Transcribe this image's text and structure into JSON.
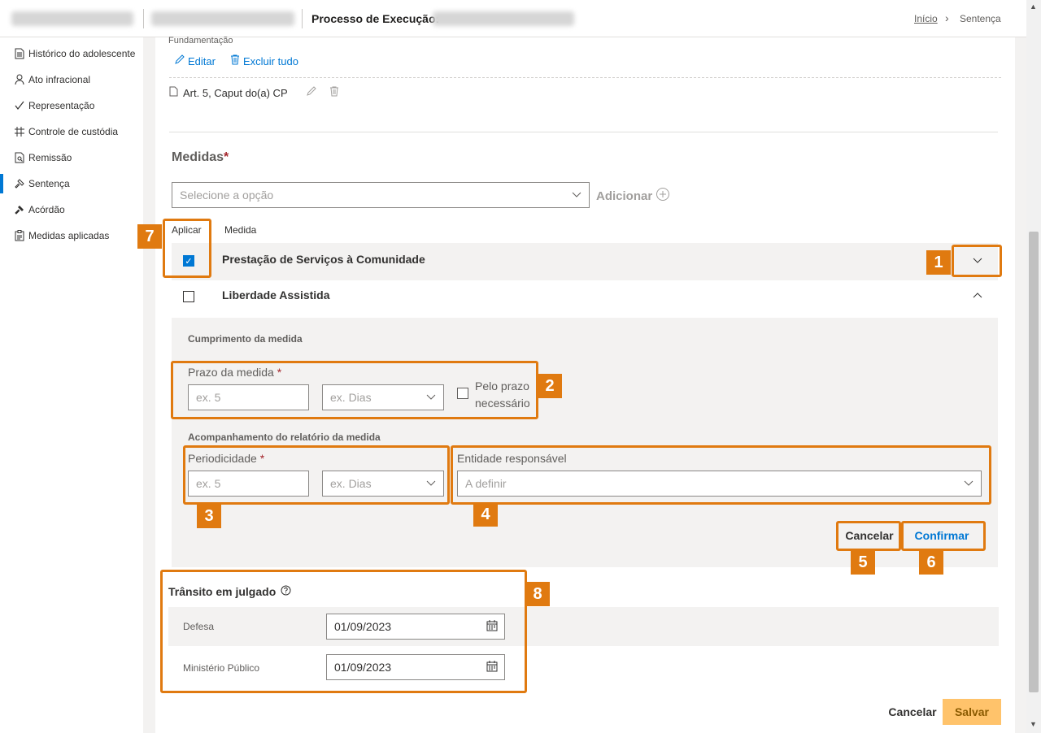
{
  "header": {
    "process_label": "Processo de Execução:",
    "breadcrumb_home": "Início",
    "breadcrumb_current": "Sentença"
  },
  "sidebar": {
    "items": [
      {
        "label": "Histórico do adolescente",
        "icon": "document-icon"
      },
      {
        "label": "Ato infracional",
        "icon": "person-icon"
      },
      {
        "label": "Representação",
        "icon": "check-icon"
      },
      {
        "label": "Controle de custódia",
        "icon": "grid-icon"
      },
      {
        "label": "Remissão",
        "icon": "document-search-icon"
      },
      {
        "label": "Sentença",
        "icon": "gavel-icon",
        "active": true
      },
      {
        "label": "Acórdão",
        "icon": "gavel-filled-icon"
      },
      {
        "label": "Medidas aplicadas",
        "icon": "clipboard-icon"
      }
    ]
  },
  "fundamentacao": {
    "label": "Fundamentação",
    "edit_label": "Editar",
    "delete_all_label": "Excluir tudo",
    "item_label": "Art. 5, Caput do(a) CP"
  },
  "medidas": {
    "title": "Medidas",
    "required_mark": "*",
    "select_placeholder": "Selecione a opção",
    "add_label": "Adicionar",
    "col_apply": "Aplicar",
    "col_measure": "Medida",
    "rows": [
      {
        "label": "Prestação de Serviços à Comunidade",
        "checked": true
      },
      {
        "label": "Liberdade Assistida",
        "checked": false
      }
    ]
  },
  "detail": {
    "cumprimento_label": "Cumprimento da medida",
    "prazo_label": "Prazo da medida",
    "prazo_placeholder": "ex. 5",
    "prazo_unit_placeholder": "ex. Dias",
    "pelo_prazo_line1": "Pelo prazo",
    "pelo_prazo_line2": "necessário",
    "acompanhamento_label": "Acompanhamento do relatório da medida",
    "periodicidade_label": "Periodicidade",
    "periodicidade_placeholder": "ex. 5",
    "periodicidade_unit_placeholder": "ex. Dias",
    "entidade_label": "Entidade responsável",
    "entidade_placeholder": "A definir",
    "cancel_label": "Cancelar",
    "confirm_label": "Confirmar"
  },
  "transito": {
    "title": "Trânsito em julgado",
    "rows": [
      {
        "label": "Defesa",
        "value": "01/09/2023"
      },
      {
        "label": "Ministério Público",
        "value": "01/09/2023"
      }
    ]
  },
  "footer": {
    "cancel_label": "Cancelar",
    "save_label": "Salvar"
  },
  "callouts": [
    "1",
    "2",
    "3",
    "4",
    "5",
    "6",
    "7",
    "8"
  ],
  "colors": {
    "accent": "#0078d4",
    "callout": "#e07a10",
    "save_button": "#ffc36b"
  }
}
